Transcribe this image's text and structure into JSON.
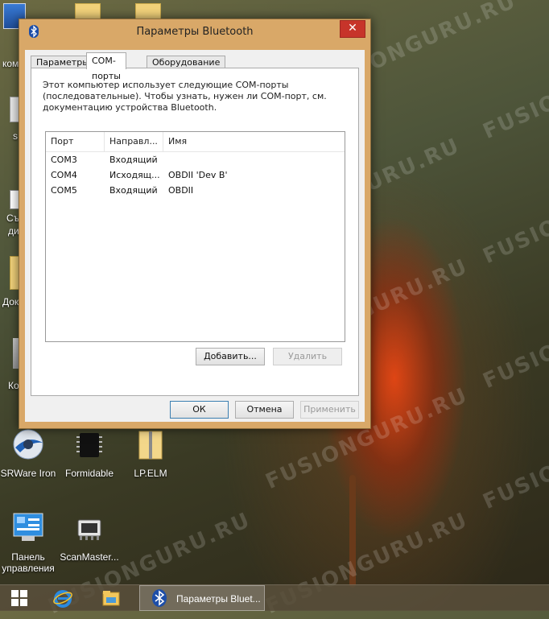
{
  "watermark": "FUSIONGURU.RU",
  "window": {
    "title": "Параметры Bluetooth",
    "close_symbol": "✕",
    "tabs": [
      {
        "label": "Параметры",
        "active": false
      },
      {
        "label": "COM-порты",
        "active": true
      },
      {
        "label": "Оборудование",
        "active": false
      }
    ],
    "description": "Этот компьютер использует следующие COM-порты (последовательные). Чтобы узнать, нужен ли COM-порт, см. документацию устройства Bluetooth.",
    "columns": [
      "Порт",
      "Направл...",
      "Имя"
    ],
    "rows": [
      {
        "port": "COM3",
        "direction": "Входящий",
        "name": ""
      },
      {
        "port": "COM4",
        "direction": "Исходящ...",
        "name": "OBDII 'Dev B'"
      },
      {
        "port": "COM5",
        "direction": "Входящий",
        "name": "OBDII"
      }
    ],
    "add_button": "Добавить...",
    "remove_button": "Удалить",
    "ok_button": "ОК",
    "cancel_button": "Отмена",
    "apply_button": "Применить"
  },
  "desktop": {
    "partial_labels": [
      "ком",
      "s",
      "Съ",
      "ди",
      "Док",
      "Ко"
    ],
    "icons": [
      {
        "label": "SRWare Iron"
      },
      {
        "label": "Formidable"
      },
      {
        "label": "LP.ELM"
      },
      {
        "label": "Панель управления"
      },
      {
        "label": "ScanMaster..."
      }
    ]
  },
  "taskbar": {
    "active_window_label": "Параметры Bluet..."
  },
  "colors": {
    "close_button": "#c7342a",
    "window_frame": "#d9a868",
    "taskbar": "#5a503c"
  }
}
